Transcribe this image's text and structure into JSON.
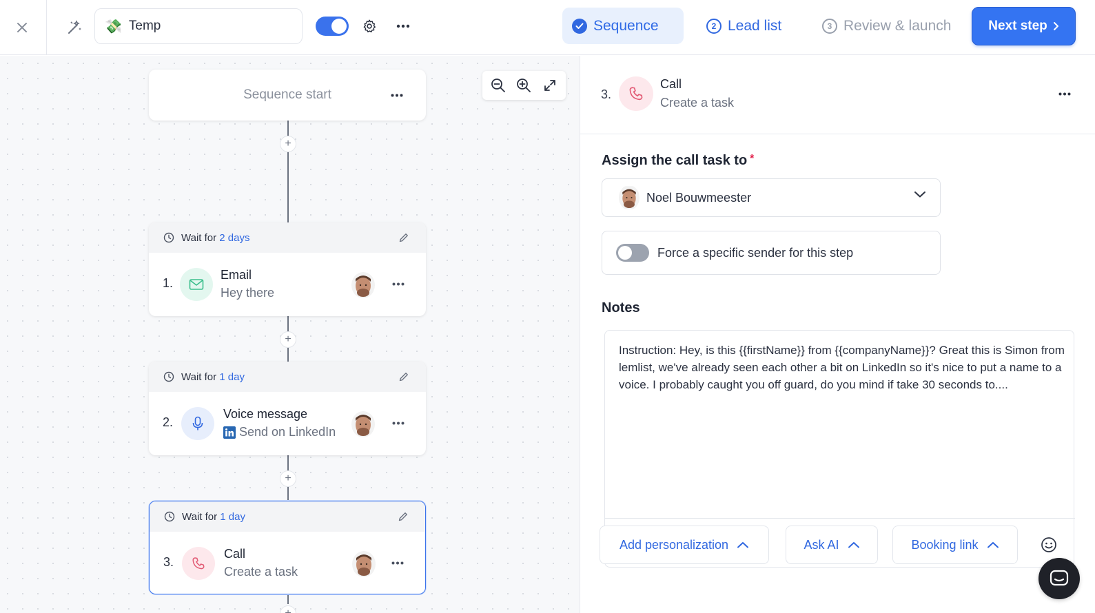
{
  "app": {
    "campaign_name": "Temp",
    "campaign_emoji": "💸"
  },
  "header": {
    "tabs": [
      {
        "label": "Sequence",
        "state": "done"
      },
      {
        "number": "2",
        "label": "Lead list",
        "state": "todo"
      },
      {
        "number": "3",
        "label": "Review & launch",
        "state": "future"
      }
    ],
    "next_label": "Next step",
    "toggle_on": true
  },
  "canvas": {
    "start_label": "Sequence start",
    "steps": [
      {
        "wait_prefix": "Wait for",
        "wait_value": "2 days",
        "number": "1.",
        "title": "Email",
        "subtitle": "Hey there",
        "icon": "mail-icon"
      },
      {
        "wait_prefix": "Wait for",
        "wait_value": "1 day",
        "number": "2.",
        "title": "Voice message",
        "subtitle": "Send on LinkedIn",
        "icon": "microphone-icon"
      },
      {
        "wait_prefix": "Wait for",
        "wait_value": "1 day",
        "number": "3.",
        "title": "Call",
        "subtitle": "Create a task",
        "icon": "phone-icon",
        "selected": true
      }
    ]
  },
  "panel": {
    "number": "3.",
    "title": "Call",
    "subtitle": "Create a task",
    "assign_label": "Assign the call task to",
    "required_mark": "*",
    "assignee": "Noel Bouwmeester",
    "force_label": "Force a specific sender for this step",
    "force_on": false,
    "notes_label": "Notes",
    "notes_text": "Instruction: Hey, is this {{firstName}} from {{companyName}}? Great this is Simon from lemlist, we've already seen each other a bit on LinkedIn so it's nice to put a name to a voice. I probably caught you off guard, do you mind if take 30 seconds to....",
    "tools": {
      "personalization": "Add personalization",
      "ask_ai": "Ask AI",
      "booking": "Booking link"
    }
  },
  "colors": {
    "accent": "#3474f2",
    "link": "#3168e0",
    "email_bg": "#e3f7ef",
    "voice_bg": "#e7eefc",
    "call_bg": "#fde8ec",
    "call_icon": "#e25a74"
  }
}
